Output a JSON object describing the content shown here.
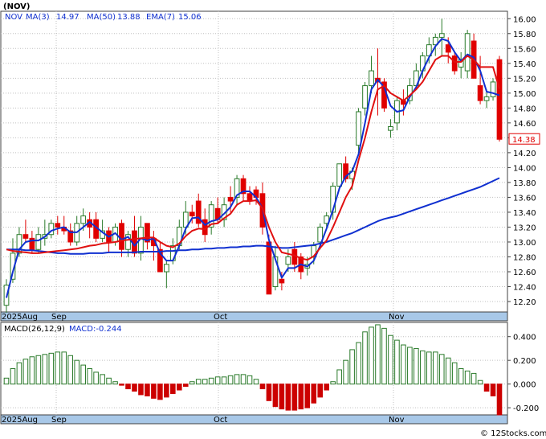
{
  "ticker_title": "(NOV)",
  "indicator_legend": {
    "symbol": "NOV",
    "ma3_label": "MA(3)",
    "ma3_value": "14.97",
    "ma50_label": "MA(50)",
    "ma50_value": "13.88",
    "ema7_label": "EMA(7)",
    "ema7_value": "15.06"
  },
  "macd_legend": {
    "label": "MACD(26,12,9)",
    "value_label": "MACD:-0.244"
  },
  "watermark": "© 12Stocks.com",
  "price_tag": "14.38",
  "x_axis_labels": [
    "2025Aug",
    "Sep",
    "Oct",
    "Nov"
  ],
  "colors": {
    "up": "#2a7a2a",
    "down": "#e00000",
    "ma_fast": "#1030d0",
    "ema": "#e01010",
    "frame": "#404040",
    "grid": "#c0c0c0",
    "axis_band": "#a8c8e8",
    "macd_up": "#2a7a2a",
    "macd_down": "#cc0000"
  },
  "chart_data": [
    {
      "type": "candlestick",
      "title": "(NOV)",
      "y_ticks": [
        "12.20",
        "12.40",
        "12.60",
        "12.80",
        "13.00",
        "13.20",
        "13.40",
        "13.60",
        "13.80",
        "14.00",
        "14.20",
        "14.40",
        "14.60",
        "14.80",
        "15.00",
        "15.20",
        "15.40",
        "15.60",
        "15.80",
        "16.00"
      ],
      "ylim": [
        12.06,
        16.1
      ],
      "grid": true,
      "last_price": 14.38,
      "candles": [
        [
          12.15,
          12.5,
          12.05,
          12.42
        ],
        [
          12.5,
          13.05,
          12.45,
          12.85
        ],
        [
          12.85,
          13.2,
          12.8,
          13.1
        ],
        [
          13.1,
          13.3,
          13.0,
          13.05
        ],
        [
          13.05,
          13.15,
          12.85,
          12.9
        ],
        [
          12.9,
          13.2,
          12.85,
          13.1
        ],
        [
          13.05,
          13.3,
          12.95,
          13.1
        ],
        [
          13.1,
          13.3,
          13.05,
          13.25
        ],
        [
          13.25,
          13.35,
          13.1,
          13.2
        ],
        [
          13.2,
          13.35,
          13.1,
          13.15
        ],
        [
          13.15,
          13.25,
          12.95,
          13.0
        ],
        [
          13.0,
          13.35,
          12.95,
          13.25
        ],
        [
          13.25,
          13.45,
          13.15,
          13.35
        ],
        [
          13.3,
          13.4,
          13.05,
          13.2
        ],
        [
          13.3,
          13.4,
          13.0,
          13.05
        ],
        [
          13.05,
          13.3,
          13.0,
          13.15
        ],
        [
          13.15,
          13.2,
          12.85,
          13.0
        ],
        [
          13.0,
          13.25,
          12.95,
          13.2
        ],
        [
          13.25,
          13.3,
          12.8,
          12.9
        ],
        [
          12.9,
          13.15,
          12.8,
          13.1
        ],
        [
          13.15,
          13.35,
          12.8,
          12.85
        ],
        [
          12.85,
          13.35,
          12.75,
          13.2
        ],
        [
          13.25,
          13.25,
          12.9,
          13.0
        ],
        [
          13.05,
          13.15,
          12.75,
          12.95
        ],
        [
          12.9,
          13.0,
          12.6,
          12.6
        ],
        [
          12.6,
          12.75,
          12.38,
          12.7
        ],
        [
          12.75,
          13.05,
          12.7,
          12.95
        ],
        [
          12.95,
          13.3,
          12.9,
          13.2
        ],
        [
          13.2,
          13.55,
          13.1,
          13.4
        ],
        [
          13.4,
          13.5,
          13.25,
          13.35
        ],
        [
          13.55,
          13.65,
          13.2,
          13.25
        ],
        [
          13.3,
          13.45,
          13.0,
          13.1
        ],
        [
          13.2,
          13.55,
          13.1,
          13.5
        ],
        [
          13.45,
          13.6,
          13.25,
          13.3
        ],
        [
          13.3,
          13.6,
          13.2,
          13.5
        ],
        [
          13.6,
          13.75,
          13.4,
          13.55
        ],
        [
          13.6,
          13.9,
          13.5,
          13.85
        ],
        [
          13.85,
          13.9,
          13.55,
          13.65
        ],
        [
          13.65,
          13.75,
          13.5,
          13.55
        ],
        [
          13.7,
          13.75,
          13.5,
          13.6
        ],
        [
          13.65,
          13.8,
          13.1,
          13.2
        ],
        [
          13.0,
          13.1,
          12.3,
          12.3
        ],
        [
          12.4,
          12.95,
          12.35,
          12.8
        ],
        [
          12.5,
          12.6,
          12.35,
          12.45
        ],
        [
          12.7,
          12.9,
          12.6,
          12.8
        ],
        [
          12.9,
          13.0,
          12.6,
          12.7
        ],
        [
          12.8,
          12.85,
          12.5,
          12.6
        ],
        [
          12.65,
          12.8,
          12.55,
          12.7
        ],
        [
          12.8,
          13.0,
          12.7,
          12.95
        ],
        [
          13.0,
          13.25,
          12.9,
          13.2
        ],
        [
          13.25,
          13.4,
          13.2,
          13.35
        ],
        [
          13.4,
          13.8,
          13.3,
          13.75
        ],
        [
          13.75,
          14.05,
          13.7,
          14.05
        ],
        [
          14.05,
          14.15,
          13.8,
          13.85
        ],
        [
          13.85,
          14.0,
          13.7,
          13.95
        ],
        [
          14.3,
          14.8,
          14.2,
          14.75
        ],
        [
          14.8,
          15.15,
          14.7,
          15.1
        ],
        [
          15.1,
          15.5,
          15.0,
          15.3
        ],
        [
          15.2,
          15.6,
          14.7,
          15.15
        ],
        [
          15.15,
          15.2,
          14.75,
          14.8
        ],
        [
          14.5,
          14.65,
          14.4,
          14.55
        ],
        [
          14.6,
          14.95,
          14.5,
          14.9
        ],
        [
          14.9,
          15.05,
          14.7,
          14.85
        ],
        [
          14.9,
          15.2,
          14.85,
          15.1
        ],
        [
          15.1,
          15.4,
          15.05,
          15.3
        ],
        [
          15.3,
          15.55,
          15.2,
          15.5
        ],
        [
          15.5,
          15.75,
          15.4,
          15.65
        ],
        [
          15.65,
          15.8,
          15.5,
          15.75
        ],
        [
          15.75,
          16.0,
          15.5,
          15.8
        ],
        [
          15.65,
          15.75,
          15.4,
          15.55
        ],
        [
          15.5,
          15.55,
          15.25,
          15.3
        ],
        [
          15.35,
          15.55,
          15.2,
          15.45
        ],
        [
          15.3,
          15.85,
          15.2,
          15.8
        ],
        [
          15.7,
          15.8,
          15.25,
          15.2
        ],
        [
          15.1,
          15.5,
          14.85,
          14.9
        ],
        [
          14.9,
          15.05,
          14.8,
          14.95
        ],
        [
          14.95,
          15.2,
          14.9,
          15.15
        ],
        [
          15.45,
          15.5,
          14.35,
          14.38
        ]
      ],
      "series": [
        {
          "name": "MA(3)",
          "color": "#1030d0",
          "values": [
            12.25,
            12.6,
            12.9,
            13.0,
            13.02,
            13.02,
            13.07,
            13.15,
            13.18,
            13.2,
            13.13,
            13.13,
            13.2,
            13.27,
            13.2,
            13.13,
            13.07,
            13.12,
            13.03,
            13.07,
            12.95,
            13.05,
            13.02,
            13.05,
            12.85,
            12.75,
            12.75,
            12.95,
            13.18,
            13.32,
            13.33,
            13.23,
            13.28,
            13.3,
            13.38,
            13.47,
            13.63,
            13.68,
            13.68,
            13.6,
            13.45,
            13.03,
            12.77,
            12.52,
            12.65,
            12.65,
            12.7,
            12.67,
            12.75,
            12.95,
            13.18,
            13.43,
            13.72,
            13.88,
            13.95,
            14.18,
            14.6,
            15.05,
            15.18,
            15.08,
            14.83,
            14.75,
            14.77,
            14.95,
            15.08,
            15.3,
            15.48,
            15.63,
            15.73,
            15.7,
            15.55,
            15.43,
            15.52,
            15.48,
            15.3,
            15.02,
            15.0,
            14.97
          ]
        },
        {
          "name": "MA(50)",
          "color": "#1030d0",
          "values": [
            12.9,
            12.9,
            12.9,
            12.89,
            12.89,
            12.88,
            12.87,
            12.86,
            12.85,
            12.85,
            12.84,
            12.84,
            12.84,
            12.85,
            12.85,
            12.85,
            12.86,
            12.86,
            12.86,
            12.86,
            12.86,
            12.87,
            12.87,
            12.87,
            12.87,
            12.88,
            12.88,
            12.89,
            12.89,
            12.9,
            12.9,
            12.91,
            12.91,
            12.92,
            12.92,
            12.93,
            12.93,
            12.94,
            12.94,
            12.95,
            12.95,
            12.94,
            12.93,
            12.92,
            12.92,
            12.93,
            12.94,
            12.95,
            12.96,
            12.98,
            13.0,
            13.03,
            13.06,
            13.09,
            13.12,
            13.16,
            13.2,
            13.24,
            13.28,
            13.31,
            13.33,
            13.35,
            13.38,
            13.41,
            13.44,
            13.47,
            13.5,
            13.53,
            13.56,
            13.59,
            13.62,
            13.65,
            13.68,
            13.71,
            13.74,
            13.78,
            13.82,
            13.86
          ]
        },
        {
          "name": "EMA(7)",
          "color": "#e01010",
          "values": [
            12.9,
            12.88,
            12.87,
            12.86,
            12.85,
            12.85,
            12.86,
            12.87,
            12.88,
            12.89,
            12.9,
            12.91,
            12.93,
            12.95,
            12.96,
            12.98,
            12.99,
            13.0,
            13.02,
            13.03,
            13.04,
            13.05,
            13.06,
            13.06,
            13.0,
            12.95,
            12.93,
            12.98,
            13.08,
            13.15,
            13.18,
            13.17,
            13.24,
            13.25,
            13.32,
            13.38,
            13.5,
            13.55,
            13.55,
            13.56,
            13.45,
            13.2,
            13.0,
            12.86,
            12.84,
            12.82,
            12.78,
            12.76,
            12.81,
            12.92,
            13.02,
            13.2,
            13.4,
            13.6,
            13.75,
            14.1,
            14.4,
            14.75,
            15.05,
            15.1,
            15.0,
            14.95,
            14.9,
            14.97,
            15.05,
            15.15,
            15.3,
            15.45,
            15.5,
            15.5,
            15.42,
            15.42,
            15.5,
            15.45,
            15.35,
            15.35,
            15.35,
            15.06
          ]
        }
      ]
    },
    {
      "type": "bar",
      "title": "MACD(26,12,9)",
      "y_ticks": [
        "0.400",
        "0.200",
        "0.000",
        "-0.200"
      ],
      "ylim": [
        -0.26,
        0.52
      ],
      "values": [
        0.05,
        0.13,
        0.18,
        0.21,
        0.23,
        0.24,
        0.25,
        0.26,
        0.27,
        0.27,
        0.24,
        0.2,
        0.16,
        0.13,
        0.1,
        0.08,
        0.05,
        0.02,
        -0.01,
        -0.04,
        -0.06,
        -0.09,
        -0.1,
        -0.12,
        -0.13,
        -0.11,
        -0.08,
        -0.05,
        -0.02,
        0.02,
        0.04,
        0.04,
        0.05,
        0.06,
        0.06,
        0.07,
        0.08,
        0.08,
        0.07,
        0.04,
        -0.04,
        -0.14,
        -0.19,
        -0.21,
        -0.22,
        -0.22,
        -0.21,
        -0.2,
        -0.16,
        -0.11,
        -0.05,
        0.02,
        0.12,
        0.2,
        0.29,
        0.35,
        0.44,
        0.48,
        0.5,
        0.47,
        0.41,
        0.37,
        0.33,
        0.31,
        0.3,
        0.28,
        0.27,
        0.27,
        0.25,
        0.22,
        0.18,
        0.13,
        0.11,
        0.09,
        0.03,
        -0.06,
        -0.1,
        -0.26
      ]
    }
  ]
}
